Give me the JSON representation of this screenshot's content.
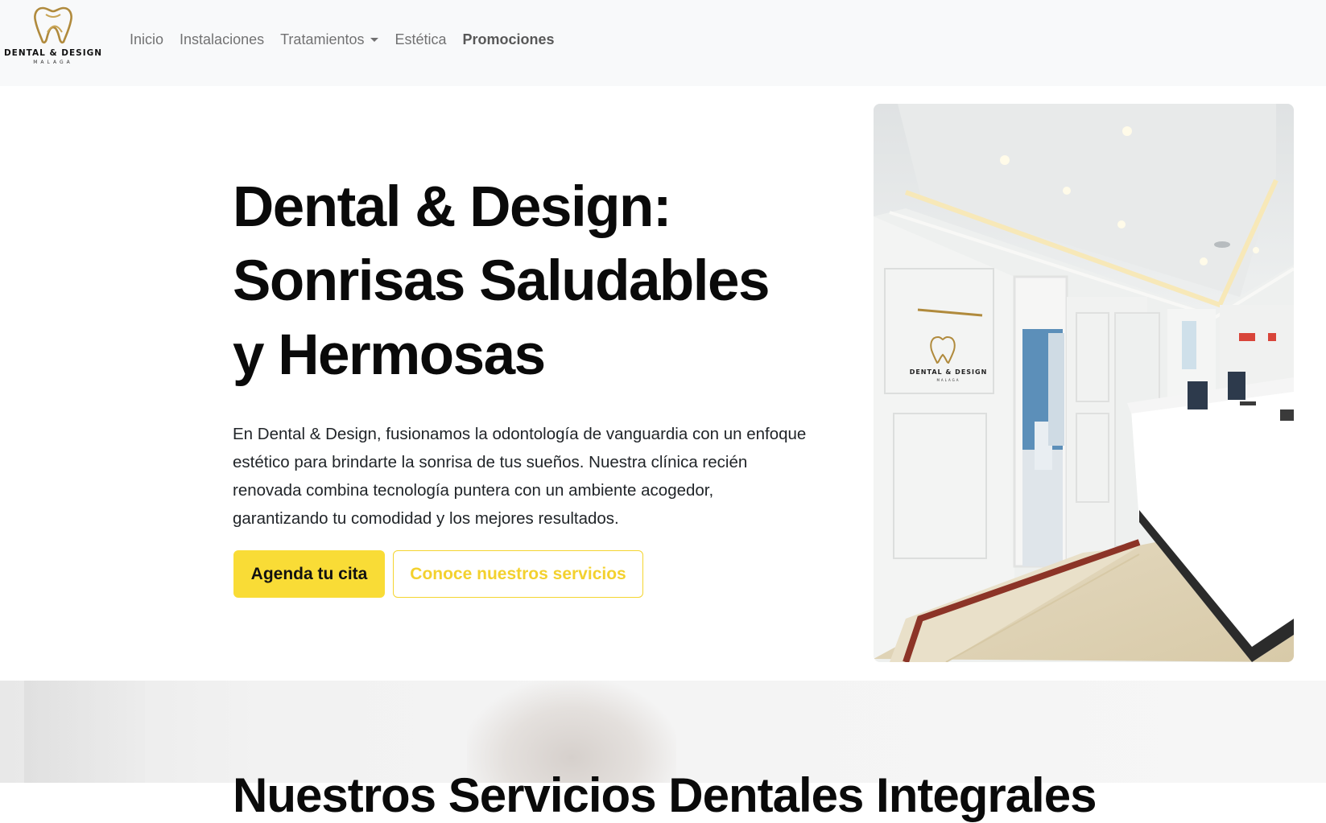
{
  "brand": {
    "name": "DENTAL & DESIGN",
    "subtitle": "MALAGA",
    "logo_icon": "tooth-logo-icon",
    "logo_color": "#b08a3c"
  },
  "nav": {
    "items": [
      {
        "label": "Inicio"
      },
      {
        "label": "Instalaciones"
      },
      {
        "label": "Tratamientos"
      },
      {
        "label": "Estética"
      },
      {
        "label": "Promociones"
      }
    ]
  },
  "hero": {
    "title_line1": "Dental & Design:",
    "title_line2": "Sonrisas Saludables",
    "title_line3": "y Hermosas",
    "text": "En Dental & Design, fusionamos la odontología de vanguardia con un enfoque estético para brindarte la sonrisa de tus sueños. Nuestra clínica recién renovada combina tecnología puntera con un ambiente acogedor, garantizando tu comodidad y los mejores resultados.",
    "primary_button": "Agenda tu cita",
    "secondary_button": "Conoce nuestros servicios",
    "accent_color": "#f9dc36"
  },
  "photo": {
    "sign_name": "DENTAL & DESIGN",
    "sign_sub": "MALAGA"
  },
  "services": {
    "title": "Nuestros Servicios Dentales Integrales"
  }
}
